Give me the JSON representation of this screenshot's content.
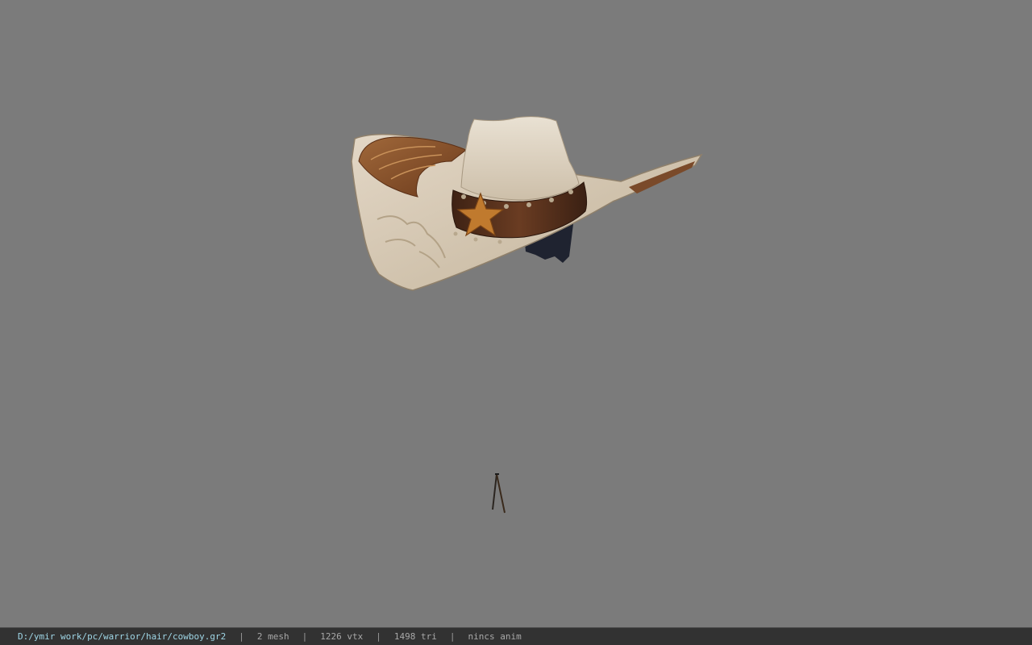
{
  "viewport": {
    "background_color": "#7b7b7b",
    "model_name": "cowboy-hat"
  },
  "status_bar": {
    "file_path": "D:/ymir work/pc/warrior/hair/cowboy.gr2",
    "mesh_count": "2 mesh",
    "vertex_count": "1226 vtx",
    "triangle_count": "1498 tri",
    "animation": "nincs anim",
    "separator": "|",
    "path_color": "#9fd6e6",
    "background_color": "#323232"
  }
}
